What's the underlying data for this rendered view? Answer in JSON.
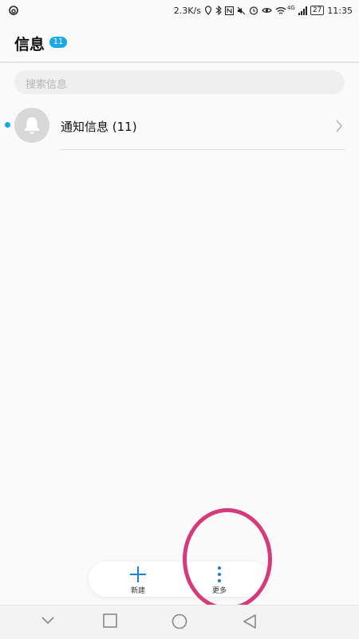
{
  "status_bar": {
    "network_speed": "2.3K/s",
    "network_type": "4G",
    "battery_level": "27",
    "time": "11:35",
    "icons": [
      "app-notification-icon",
      "location-icon",
      "bluetooth-icon",
      "nfc-icon",
      "mute-icon",
      "alarm-icon",
      "eye-icon",
      "wifi-icon",
      "signal-icon",
      "battery-icon"
    ]
  },
  "header": {
    "title": "信息",
    "unread_count": "11"
  },
  "search": {
    "placeholder": "搜索信息"
  },
  "conversations": [
    {
      "title": "通知信息 (11)",
      "icon": "bell-icon",
      "unread": true
    }
  ],
  "action_bar": {
    "new_label": "新建",
    "more_label": "更多"
  },
  "nav_bar": {
    "buttons": [
      "chevron-down-icon",
      "square-icon",
      "circle-icon",
      "back-triangle-icon"
    ]
  },
  "colors": {
    "accent": "#1aa8e8",
    "annotation": "#d63a7b",
    "background": "#fafafa"
  }
}
